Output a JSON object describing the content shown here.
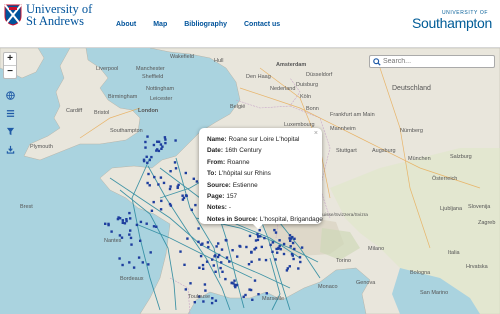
{
  "header": {
    "university_left": [
      "University of",
      "St Andrews"
    ],
    "nav": [
      "About",
      "Map",
      "Bibliography",
      "Contact us"
    ],
    "university_right": {
      "small": "UNIVERSITY OF",
      "big": "Southampton"
    }
  },
  "controls": {
    "zoom_in": "+",
    "zoom_out": "−",
    "search_placeholder": "Search..."
  },
  "map_labels": {
    "wakefield": "Wakefield",
    "hull": "Hull",
    "liverpool": "Liverpool",
    "manchester": "Manchester",
    "sheffield": "Sheffield",
    "nottingham": "Nottingham",
    "birmingham": "Birmingham",
    "leicester": "Leicester",
    "cardiff": "Cardiff",
    "bristol": "Bristol",
    "southampton": "Southampton",
    "london": "London",
    "amsterdam": "Amsterdam",
    "den_haag": "Den Haag",
    "duisburg": "Duisburg",
    "dusseldorf": "Düsseldorf",
    "koln": "Köln",
    "bonn": "Bonn",
    "frankfurt": "Frankfurt am Main",
    "mannheim": "Mannheim",
    "nurnberg": "Nürnberg",
    "stuttgart": "Stuttgart",
    "munchen": "München",
    "plymouth": "Plymouth",
    "nantes": "Nantes",
    "brest": "Brest",
    "schweiz": "Schweiz/Suisse/Svizzera/Svizra",
    "milano": "Milano",
    "torino": "Torino",
    "genova": "Genova",
    "bologna": "Bologna",
    "slovenia": "Slovenija",
    "hrvatska": "Hrvatska",
    "bordeaux": "Bordeaux",
    "toulouse": "Toulouse",
    "marseille": "Marseille",
    "monaco": "Monaco",
    "italia": "Italia",
    "sanmarino": "San Marino",
    "zagreb": "Zagreb",
    "deutschland": "Deutschland",
    "nederland": "Nederland",
    "belgie": "België",
    "luxembourg": "Luxembourg",
    "augsburg": "Augsburg",
    "salzburg": "Salzburg",
    "osterreich": "Österreich",
    "ljubljana": "Ljubljana"
  },
  "popup": {
    "close": "×",
    "rows": [
      {
        "label": "Name:",
        "value": "Roane sur Loire L'hopital"
      },
      {
        "label": "Date:",
        "value": "16th Century"
      },
      {
        "label": "From:",
        "value": "Roanne"
      },
      {
        "label": "To:",
        "value": "L'hôpital sur Rhins"
      },
      {
        "label": "Source:",
        "value": "Estienne"
      },
      {
        "label": "Page:",
        "value": "157"
      },
      {
        "label": "Notes:",
        "value": "-"
      },
      {
        "label": "Notes in Source:",
        "value": "L'hospital, Brigandage"
      }
    ]
  },
  "colors": {
    "brand": "#00539b",
    "route": "#2e8ba0",
    "marker": "#1e3e9e",
    "sea": "#aad3df",
    "land": "#e9e6dc"
  }
}
